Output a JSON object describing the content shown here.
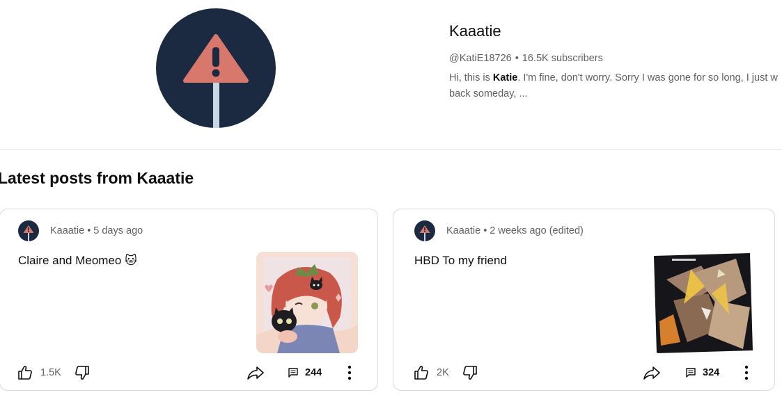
{
  "channel": {
    "name": "Kaaatie",
    "handle": "@KatiE18726",
    "subscribers": "16.5K subscribers",
    "description_prefix": "Hi, this is ",
    "description_bold": "Katie",
    "description_suffix": ". I'm fine, don't worry. Sorry I was gone for so long, I just w back someday, ...",
    "avatar_icon": "warning-sign-icon",
    "colors": {
      "avatar_bg": "#1b2a40",
      "warning": "#d8776b",
      "pole": "#c9d6e3"
    }
  },
  "section": {
    "title": "Latest posts from Kaaatie"
  },
  "posts": [
    {
      "author": "Kaaatie",
      "separator": "•",
      "time": "5 days ago",
      "text": "Claire and Meomeo 🐱",
      "likes": "1.5K",
      "comments": "244",
      "image": "anime-girl-with-black-cat-illustration"
    },
    {
      "author": "Kaaatie",
      "separator": "•",
      "time": "2 weeks ago (edited)",
      "text": "HBD To my friend",
      "likes": "2K",
      "comments": "324",
      "image": "dark-birthday-illustration"
    }
  ],
  "meta_separator": "•"
}
